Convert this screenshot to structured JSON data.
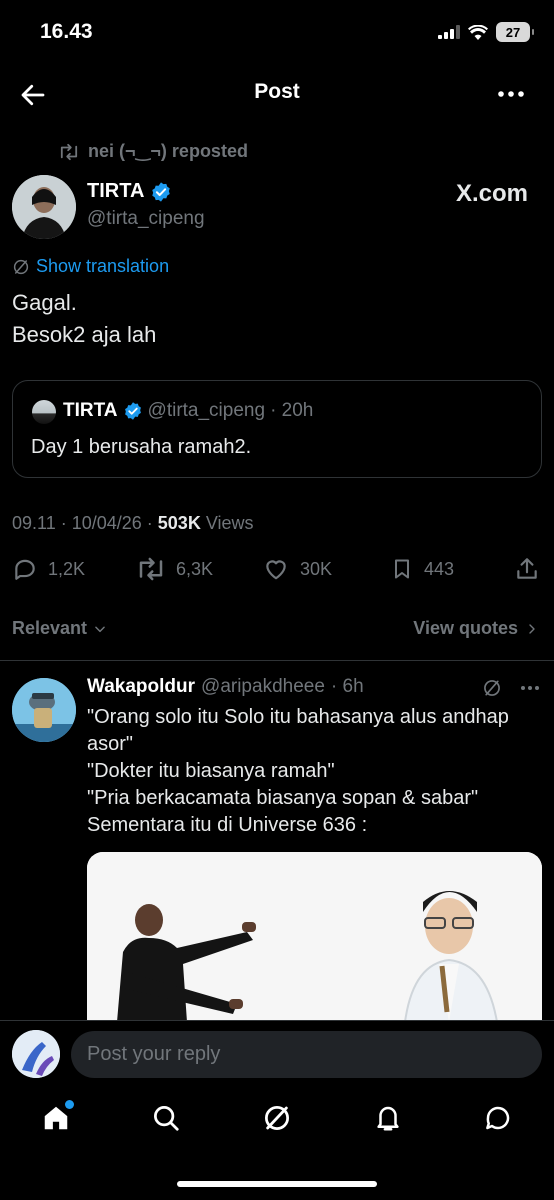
{
  "status": {
    "time": "16.43",
    "battery": "27"
  },
  "header": {
    "title": "Post"
  },
  "repost": {
    "text": "nei (¬‿¬) reposted"
  },
  "author": {
    "name": "TIRTA",
    "handle": "@tirta_cipeng",
    "watermark": "X.com"
  },
  "post": {
    "translate_label": "Show translation",
    "text": "Gagal.\nBesok2 aja lah",
    "timestamp": "09.11 · 10/04/26 · ",
    "views_count": "503K",
    "views_label": " Views"
  },
  "quote": {
    "name": "TIRTA",
    "handle": "@tirta_cipeng",
    "age": "· 20h",
    "text": "Day 1 berusaha ramah2."
  },
  "actions": {
    "replies": "1,2K",
    "reposts": "6,3K",
    "likes": "30K",
    "bookmarks": "443"
  },
  "sort": {
    "label": "Relevant",
    "view_quotes": "View quotes"
  },
  "reply": {
    "name": "Wakapoldur",
    "handle": "@aripakdheee",
    "age": "· 6h",
    "lines": [
      "\"Orang solo itu Solo itu bahasanya alus andhap asor\"",
      "\"Dokter itu biasanya ramah\"",
      "\"Pria berkacamata biasanya sopan & sabar\"",
      "Sementara itu di Universe 636 :"
    ]
  },
  "composer": {
    "placeholder": "Post your reply"
  },
  "colors": {
    "accent": "#1d9bf0",
    "background": "#000000",
    "muted": "#71767b",
    "text": "#e7e9ea"
  },
  "icons": [
    "back-arrow-icon",
    "more-icon",
    "repost-icon",
    "verified-badge-icon",
    "translate-icon",
    "reply-icon",
    "like-icon",
    "bookmark-icon",
    "share-icon",
    "chevron-down-icon",
    "chevron-right-icon",
    "grok-icon",
    "home-icon",
    "search-icon",
    "notifications-icon",
    "messages-icon"
  ]
}
